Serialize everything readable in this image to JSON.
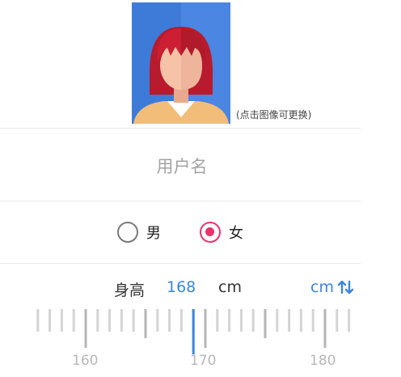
{
  "profile": {
    "avatar_hint": "(点击图像可更换)",
    "username_placeholder": "用户名"
  },
  "gender": {
    "options": [
      {
        "label": "男",
        "checked": false
      },
      {
        "label": "女",
        "checked": true
      }
    ]
  },
  "height": {
    "label": "身高",
    "value": "168",
    "unit": "cm",
    "unit_toggle_label": "cm",
    "unit_toggle_icon": "swap-vertical-icon"
  },
  "ruler": {
    "min": 156,
    "max": 183,
    "current": 169,
    "major_labels": [
      "160",
      "170",
      "180"
    ]
  },
  "colors": {
    "accent": "#3a86e0",
    "selected_radio": "#e8336d",
    "avatar_background": "#3e7bd8",
    "hair": "#cc1f33"
  }
}
